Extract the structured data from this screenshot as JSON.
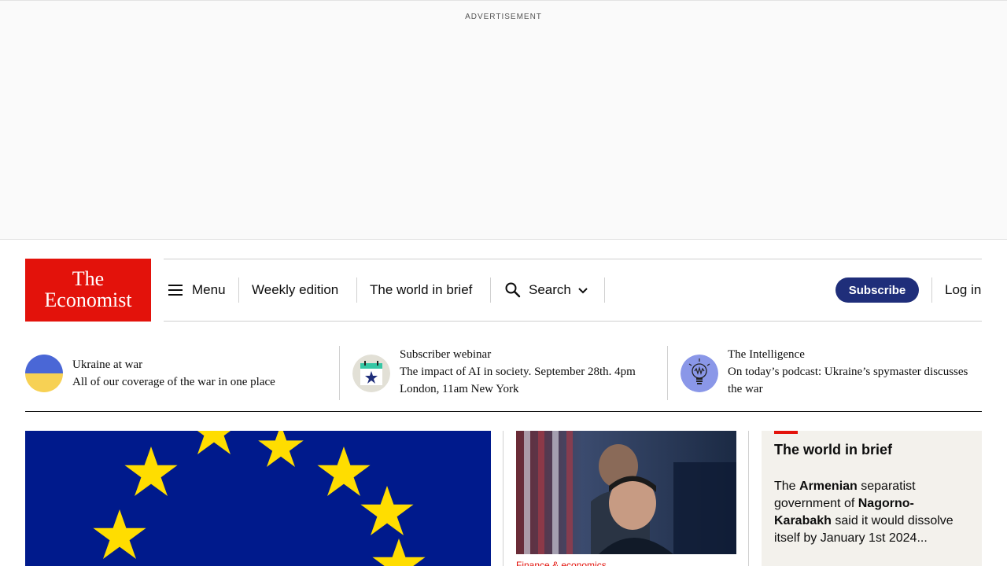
{
  "advertisement": {
    "label": "ADVERTISEMENT"
  },
  "logo": {
    "line1": "The",
    "line2": "Economist"
  },
  "nav": {
    "menu_label": "Menu",
    "weekly_edition": "Weekly edition",
    "world_in_brief": "The world in brief",
    "search_label": "Search",
    "subscribe_label": "Subscribe",
    "login_label": "Log in"
  },
  "strip": [
    {
      "title": "Ukraine at war",
      "desc": "All of our coverage of the war in one place",
      "icon": "ukraine-flag-icon"
    },
    {
      "title": "Subscriber webinar",
      "desc": "The impact of AI in society. September 28th. 4pm London, 11am New York",
      "icon": "calendar-star-icon"
    },
    {
      "title": "The Intelligence",
      "desc": "On today’s podcast: Ukraine’s spymaster discusses the war",
      "icon": "lightbulb-icon"
    }
  ],
  "articles": {
    "mid_section": "Finance & economics"
  },
  "brief": {
    "heading": "The world in brief",
    "t1": "The ",
    "b1": "Armenian",
    "t2": " separatist government of ",
    "b2": "Nagorno-Karabakh",
    "t3": " said it would dissolve itself by January 1st 2024..."
  },
  "colors": {
    "brand_red": "#e3120b",
    "subscribe_blue": "#1f2e7a",
    "eu_blue": "#001a8c",
    "eu_star": "#ffdd00"
  }
}
